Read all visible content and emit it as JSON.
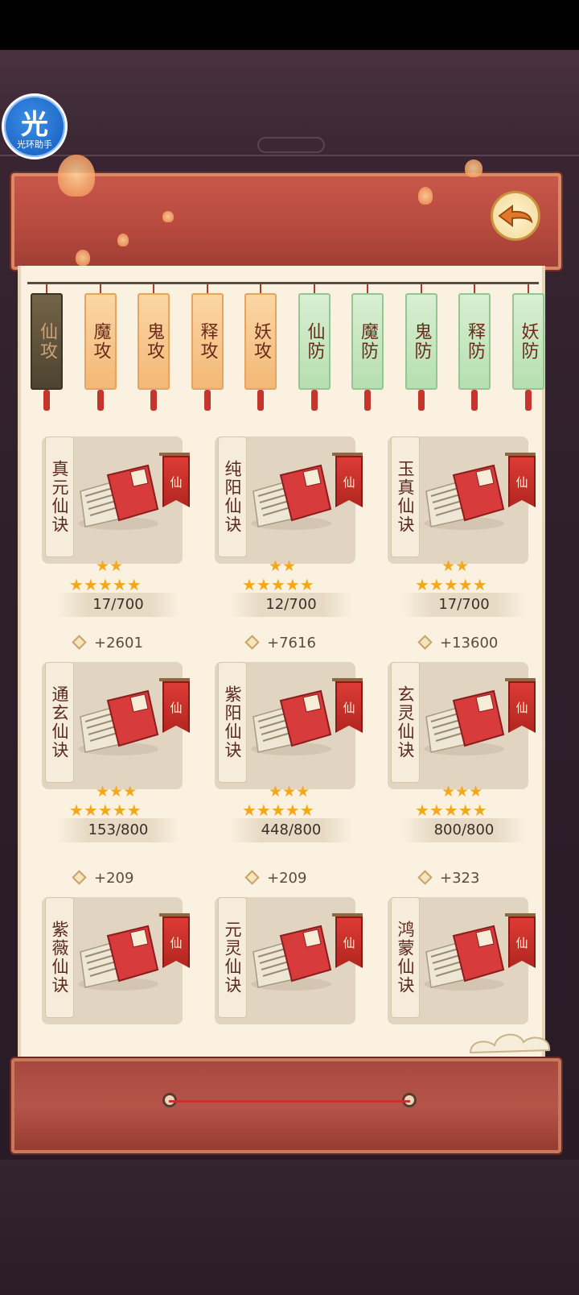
{
  "assistant": {
    "glyph": "光",
    "label": "光环助手"
  },
  "header": {
    "back_icon": "back-arrow-icon"
  },
  "tabs": [
    {
      "label": "仙攻",
      "kind": "atk",
      "active": true
    },
    {
      "label": "魔攻",
      "kind": "atk"
    },
    {
      "label": "鬼攻",
      "kind": "atk"
    },
    {
      "label": "释攻",
      "kind": "atk"
    },
    {
      "label": "妖攻",
      "kind": "atk"
    },
    {
      "label": "仙防",
      "kind": "def"
    },
    {
      "label": "魔防",
      "kind": "def"
    },
    {
      "label": "鬼防",
      "kind": "def"
    },
    {
      "label": "释防",
      "kind": "def"
    },
    {
      "label": "妖防",
      "kind": "def"
    }
  ],
  "cards": [
    {
      "name": "真元仙诀",
      "banner": "仙",
      "bonus": "",
      "rank_stars": "★★",
      "stars": "★★★★★",
      "progress": "17/700"
    },
    {
      "name": "纯阳仙诀",
      "banner": "仙",
      "bonus": "",
      "rank_stars": "★★",
      "stars": "★★★★★",
      "progress": "12/700"
    },
    {
      "name": "玉真仙诀",
      "banner": "仙",
      "bonus": "",
      "rank_stars": "★★",
      "stars": "★★★★★",
      "progress": "17/700"
    },
    {
      "name": "通玄仙诀",
      "banner": "仙",
      "bonus": "+2601",
      "rank_stars": "★★★",
      "stars": "★★★★★",
      "progress": "153/800"
    },
    {
      "name": "紫阳仙诀",
      "banner": "仙",
      "bonus": "+7616",
      "rank_stars": "★★★",
      "stars": "★★★★★",
      "progress": "448/800"
    },
    {
      "name": "玄灵仙诀",
      "banner": "仙",
      "bonus": "+13600",
      "rank_stars": "★★★",
      "stars": "★★★★★",
      "progress": "800/800"
    },
    {
      "name": "紫薇仙诀",
      "banner": "仙",
      "bonus": "+209",
      "rank_stars": "",
      "stars": "",
      "progress": ""
    },
    {
      "name": "元灵仙诀",
      "banner": "仙",
      "bonus": "+209",
      "rank_stars": "",
      "stars": "",
      "progress": ""
    },
    {
      "name": "鸿蒙仙诀",
      "banner": "仙",
      "bonus": "+323",
      "rank_stars": "",
      "stars": "",
      "progress": ""
    }
  ],
  "colors": {
    "accent_red": "#c8584a",
    "paper": "#faf1e1",
    "star": "#f2a81b"
  }
}
